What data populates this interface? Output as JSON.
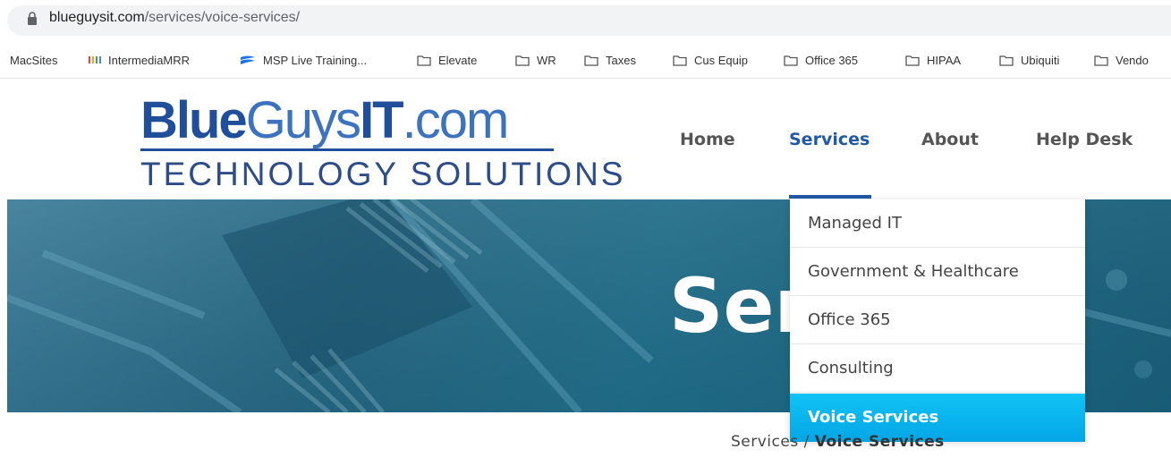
{
  "browser": {
    "url_host": "blueguysit.com",
    "url_path": "/services/voice-services/"
  },
  "bookmarks": [
    {
      "label": "MacSites",
      "icon": "none"
    },
    {
      "label": "IntermediaMRR",
      "icon": "bars-icon"
    },
    {
      "label": "MSP Live Training...",
      "icon": "wave-icon"
    },
    {
      "label": "Elevate",
      "icon": "folder-icon"
    },
    {
      "label": "WR",
      "icon": "folder-icon"
    },
    {
      "label": "Taxes",
      "icon": "folder-icon"
    },
    {
      "label": "Cus Equip",
      "icon": "folder-icon"
    },
    {
      "label": "Office 365",
      "icon": "folder-icon"
    },
    {
      "label": "HIPAA",
      "icon": "folder-icon"
    },
    {
      "label": "Ubiquiti",
      "icon": "folder-icon"
    },
    {
      "label": "Vendo",
      "icon": "folder-icon"
    }
  ],
  "logo": {
    "bold_part": "Blue",
    "light_part": "Guys",
    "bold_part2": "IT",
    "light_part2": ".com",
    "tagline": "TECHNOLOGY SOLUTIONS"
  },
  "nav": {
    "home": "Home",
    "services": "Services",
    "about": "About",
    "help_desk": "Help Desk"
  },
  "hero": {
    "title": "Ser"
  },
  "dropdown": {
    "items": [
      {
        "label": "Managed IT"
      },
      {
        "label": "Government & Healthcare"
      },
      {
        "label": "Office 365"
      },
      {
        "label": "Consulting"
      },
      {
        "label": "Voice Services",
        "active": true
      }
    ]
  },
  "breadcrumb": {
    "parent": "Services",
    "separator": "/",
    "current": "Voice Services"
  },
  "colors": {
    "brand_blue": "#1f4e9a",
    "nav_active": "#1f5aa6",
    "dropdown_active": "#04a6e6"
  }
}
